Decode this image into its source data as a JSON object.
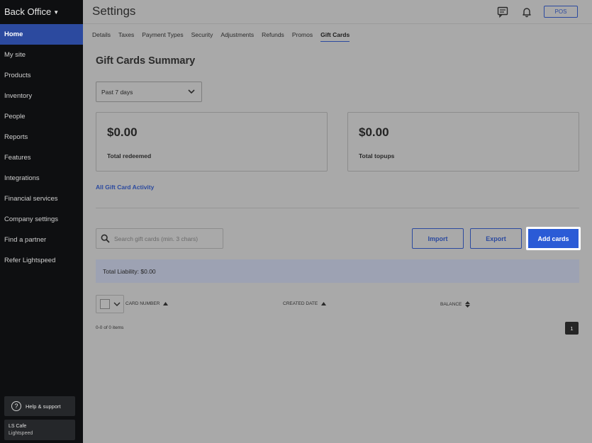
{
  "sidebar": {
    "brand": "Back Office",
    "items": [
      {
        "label": "Home"
      },
      {
        "label": "My site"
      },
      {
        "label": "Products"
      },
      {
        "label": "Inventory"
      },
      {
        "label": "People"
      },
      {
        "label": "Reports"
      },
      {
        "label": "Features"
      },
      {
        "label": "Integrations"
      },
      {
        "label": "Financial services"
      },
      {
        "label": "Company settings"
      },
      {
        "label": "Find a partner"
      },
      {
        "label": "Refer Lightspeed"
      }
    ],
    "help_label": "Help & support",
    "account": {
      "name": "LS Cafe",
      "sub": "Lightspeed"
    }
  },
  "header": {
    "title": "Settings",
    "pos_label": "POS"
  },
  "tabs": [
    "Details",
    "Taxes",
    "Payment Types",
    "Security",
    "Adjustments",
    "Refunds",
    "Promos",
    "Gift Cards"
  ],
  "active_tab": "Gift Cards",
  "summary": {
    "title": "Gift Cards Summary",
    "range": "Past 7 days",
    "redeemed_value": "$0.00",
    "redeemed_label": "Total redeemed",
    "topups_value": "$0.00",
    "topups_label": "Total topups",
    "activity_link": "All Gift Card Activity"
  },
  "toolbar": {
    "search_placeholder": "Search gift cards (min. 3 chars)",
    "import_label": "Import",
    "export_label": "Export",
    "add_label": "Add cards"
  },
  "liability": "Total Liability: $0.00",
  "table": {
    "columns": [
      "CARD NUMBER",
      "CREATED DATE",
      "BALANCE"
    ],
    "count": "0-0 of 0 items",
    "page": "1"
  },
  "colors": {
    "accent": "#2c4a9f",
    "primary_button": "#2b5bd6",
    "sidebar_bg": "#0e0f11"
  }
}
